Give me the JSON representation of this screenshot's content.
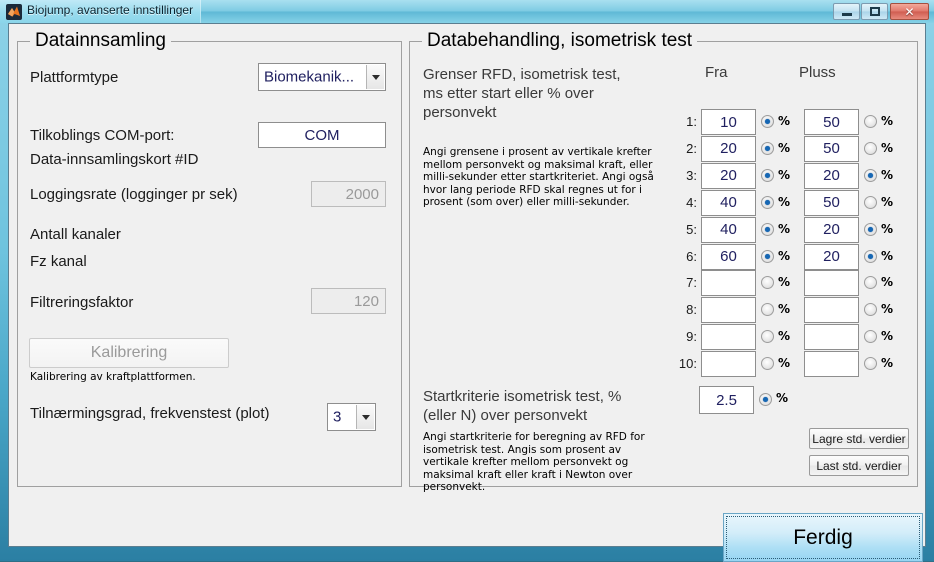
{
  "window": {
    "title": "Biojump, avanserte innstillinger",
    "icon": "matlab-icon",
    "buttons": {
      "minimize": "minimize-icon",
      "maximize": "maximize-icon",
      "close": "✕"
    }
  },
  "left_panel": {
    "title": "Datainnsamling",
    "platform_label": "Plattformtype",
    "platform_value": "Biomekanik...",
    "com_label": "Tilkoblings COM-port:",
    "com_value": "COM",
    "card_id_label": "Data-innsamlingskort #ID",
    "lograte_label": "Loggingsrate (logginger pr sek)",
    "lograte_value": "2000",
    "channels_label": "Antall kanaler",
    "fz_label": "Fz kanal",
    "filter_label": "Filtreringsfaktor",
    "filter_value": "120",
    "calibrate_button": "Kalibrering",
    "calibrate_help": "Kalibrering av kraftplattformen.",
    "approx_label": "Tilnærmingsgrad, frekvenstest (plot)",
    "approx_value": "3"
  },
  "right_panel": {
    "title": "Databehandling, isometrisk test",
    "rfd_heading": "Grenser RFD, isometrisk test,\nms etter start eller % over\npersonvekt",
    "rfd_help": "Angi grensene i prosent av vertikale krefter mellom personvekt og maksimal kraft, eller milli-sekunder etter startkriteriet. Angi også hvor lang periode RFD skal regnes ut for i prosent (som over) eller milli-sekunder.",
    "col_from": "Fra",
    "col_plus": "Pluss",
    "unit_label": "%",
    "rows": [
      {
        "num": "1:",
        "from_value": "10",
        "from_pct": true,
        "plus_value": "50",
        "plus_pct": false
      },
      {
        "num": "2:",
        "from_value": "20",
        "from_pct": true,
        "plus_value": "50",
        "plus_pct": false
      },
      {
        "num": "3:",
        "from_value": "20",
        "from_pct": true,
        "plus_value": "20",
        "plus_pct": true
      },
      {
        "num": "4:",
        "from_value": "40",
        "from_pct": true,
        "plus_value": "50",
        "plus_pct": false
      },
      {
        "num": "5:",
        "from_value": "40",
        "from_pct": true,
        "plus_value": "20",
        "plus_pct": true
      },
      {
        "num": "6:",
        "from_value": "60",
        "from_pct": true,
        "plus_value": "20",
        "plus_pct": true
      },
      {
        "num": "7:",
        "from_value": "",
        "from_pct": false,
        "plus_value": "",
        "plus_pct": false
      },
      {
        "num": "8:",
        "from_value": "",
        "from_pct": false,
        "plus_value": "",
        "plus_pct": false
      },
      {
        "num": "9:",
        "from_value": "",
        "from_pct": false,
        "plus_value": "",
        "plus_pct": false
      },
      {
        "num": "10:",
        "from_value": "",
        "from_pct": false,
        "plus_value": "",
        "plus_pct": false
      }
    ],
    "start_heading": "Startkriterie isometrisk test, %\n(eller N) over personvekt",
    "start_help": "Angi startkriterie for beregning av RFD for isometrisk test. Angis som prosent av vertikale krefter mellom personvekt og maksimal kraft eller kraft i Newton over personvekt.",
    "start_value": "2.5",
    "start_pct": true,
    "save_defaults_button": "Lagre std. verdier",
    "load_defaults_button": "Last std. verdier"
  },
  "footer": {
    "done_button": "Ferdig"
  },
  "colors": {
    "accent": "#1667b4",
    "frame": "#6ec3de",
    "client": "#f0f0f0",
    "done_button": "#addff5"
  }
}
